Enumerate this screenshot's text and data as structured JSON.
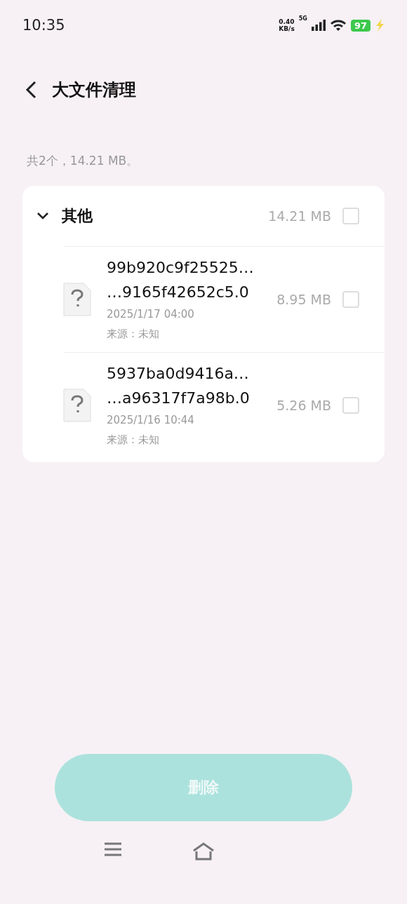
{
  "status_bar": {
    "time": "10:35",
    "net_speed": [
      "0.40",
      "KB/s"
    ],
    "network": "5G",
    "battery": "97",
    "charging": true
  },
  "header": {
    "title": "大文件清理"
  },
  "summary": "共2个，14.21 MB。",
  "groups": [
    {
      "name": "其他",
      "size": "14.21 MB",
      "expanded": true,
      "checked": false,
      "files": [
        {
          "name_lines": [
            "99b920c9f25525…",
            "…9165f42652c5.0"
          ],
          "date": "2025/1/17 04:00",
          "source": "来源：未知",
          "size": "8.95 MB",
          "checked": false
        },
        {
          "name_lines": [
            "5937ba0d9416a…",
            "…a96317f7a98b.0"
          ],
          "date": "2025/1/16 10:44",
          "source": "来源：未知",
          "size": "5.26 MB",
          "checked": false
        }
      ]
    }
  ],
  "delete_button": {
    "label": "删除",
    "disabled": true
  }
}
